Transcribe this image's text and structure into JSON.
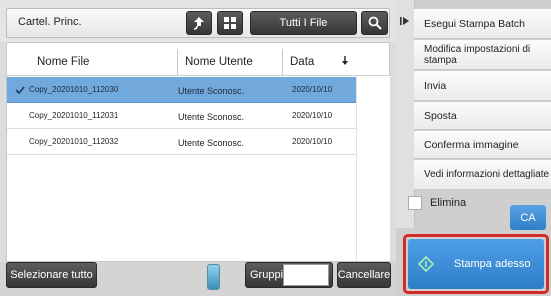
{
  "folder": {
    "label": "Cartel. Princ."
  },
  "toolbar": {
    "filter_label": "Tutti I File"
  },
  "table": {
    "columns": [
      "Nome File",
      "Nome Utente",
      "Data"
    ],
    "rows": [
      {
        "name": "Copy_20201010_112030",
        "user": "Utente Sconosc.",
        "date": "2020/10/10",
        "selected": true
      },
      {
        "name": "Copy_20201010_112031",
        "user": "Utente Sconosc.",
        "date": "2020/10/10",
        "selected": false
      },
      {
        "name": "Copy_20201010_112032",
        "user": "Utente Sconosc.",
        "date": "2020/10/10",
        "selected": false
      }
    ]
  },
  "bottom": {
    "select_all": "Selezionare tutto",
    "groups": "Gruppi",
    "cancel": "Cancellare"
  },
  "menu": {
    "items": [
      "Esegui Stampa Batch",
      "Modifica impostazioni di stampa",
      "Invia",
      "Sposta",
      "Conferma immagine",
      "Vedi informazioni dettagliate"
    ],
    "delete_label": "Elimina",
    "ca_label": "CA",
    "print_now": "Stampa adesso"
  },
  "colors": {
    "selected_row": "#72a9dd",
    "print_button": "#3b8fd6",
    "highlight_border": "#d42a2a",
    "ca_button": "#3d8fd6"
  }
}
